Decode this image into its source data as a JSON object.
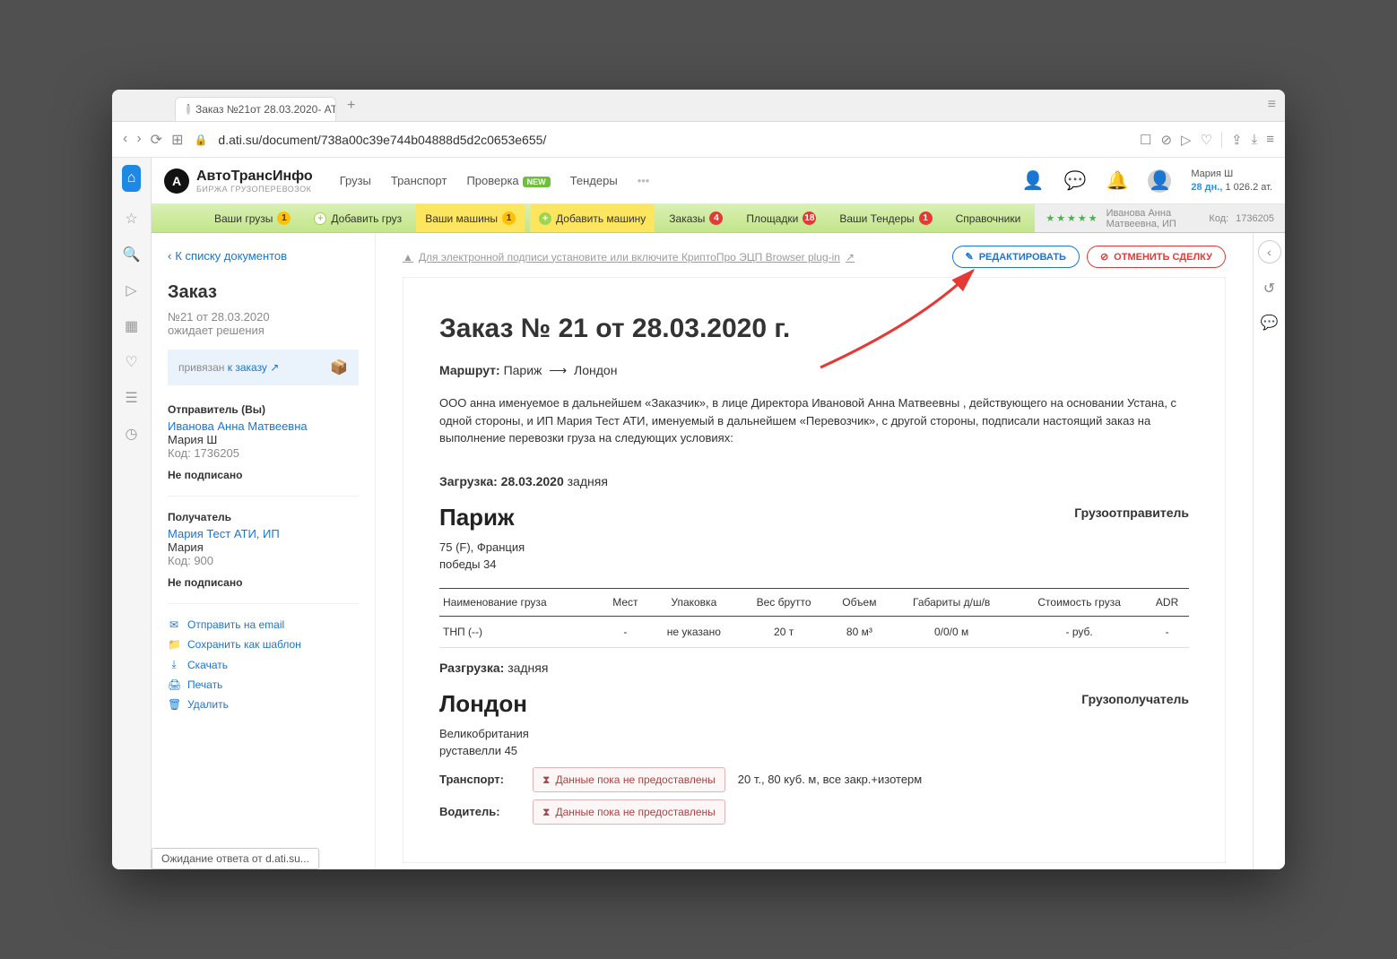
{
  "browser": {
    "tab_title": "Заказ №21от 28.03.2020- АТ",
    "url": "d.ati.su/document/738a00c39e744b04888d5d2c0653e655/",
    "status": "Ожидание ответа от d.ati.su..."
  },
  "brand": {
    "title": "АвтоТрансИнфо",
    "subtitle": "БИРЖА ГРУЗОПЕРЕВОЗОК"
  },
  "topnav": {
    "cargo": "Грузы",
    "transport": "Транспорт",
    "check": "Проверка",
    "new_badge": "NEW",
    "tenders": "Тендеры"
  },
  "user": {
    "name": "Мария Ш",
    "days": "28 дн.,",
    "rating": "1 026.2 ат."
  },
  "subnav": {
    "your_cargo": "Ваши грузы",
    "your_cargo_cnt": "1",
    "add_cargo": "Добавить груз",
    "your_vehicles": "Ваши машины",
    "your_vehicles_cnt": "1",
    "add_vehicle": "Добавить машину",
    "orders": "Заказы",
    "orders_cnt": "4",
    "platforms": "Площадки",
    "platforms_cnt": "18",
    "your_tenders": "Ваши Тендеры",
    "your_tenders_cnt": "1",
    "refs": "Справочники",
    "right_name": "Иванова Анна Матвеевна, ИП",
    "right_code_label": "Код:",
    "right_code": "1736205"
  },
  "left": {
    "back": "К списку документов",
    "title": "Заказ",
    "num_date": "№21 от 28.03.2020",
    "status": "ожидает решения",
    "attached_prefix": "привязан ",
    "attached_link": "к заказу",
    "sender_title": "Отправитель (Вы)",
    "sender_name": "Иванова Анна Матвеевна",
    "sender_person": "Мария Ш",
    "sender_code": "Код: 1736205",
    "not_signed": "Не подписано",
    "recipient_title": "Получатель",
    "recipient_name": "Мария Тест АТИ, ИП",
    "recipient_person": "Мария",
    "recipient_code": "Код: 900",
    "actions": {
      "email": "Отправить на email",
      "template": "Сохранить как шаблон",
      "download": "Скачать",
      "print": "Печать",
      "delete": "Удалить"
    }
  },
  "notice": "Для электронной подписи установите или включите КриптоПро ЭЦП Browser plug-in",
  "buttons": {
    "edit": "РЕДАКТИРОВАТЬ",
    "cancel": "ОТМЕНИТЬ СДЕЛКУ"
  },
  "doc": {
    "title": "Заказ №  21 от 28.03.2020 г.",
    "route_label": "Маршрут:",
    "route_from": "Париж",
    "route_to": "Лондон",
    "para": "ООО анна именуемое в дальнейшем «Заказчик», в лице Директора Ивановой Анна Матвеевны , действующего на основании Устана, с одной стороны, и ИП Мария Тест АТИ, именуемый в дальнейшем «Перевозчик», с другой стороны, подписали настоящий заказ на выполнение перевозки груза на следующих условиях:",
    "loading_label": "Загрузка:",
    "loading_date": "28.03.2020",
    "loading_type": "задняя",
    "city1": "Париж",
    "city1_sub": "75 (F), Франция",
    "city1_addr": "победы 34",
    "shipper": "Грузоотправитель",
    "table": {
      "h_name": "Наименование груза",
      "h_places": "Мест",
      "h_pack": "Упаковка",
      "h_gross": "Вес брутто",
      "h_vol": "Объем",
      "h_dims": "Габариты д/ш/в",
      "h_cost": "Стоимость груза",
      "h_adr": "ADR",
      "r_name": "ТНП (--)",
      "r_places": "-",
      "r_pack": "не указано",
      "r_gross": "20 т",
      "r_vol": "80 м³",
      "r_dims": "0/0/0 м",
      "r_cost": "- руб.",
      "r_adr": "-"
    },
    "unloading_label": "Разгрузка:",
    "unloading_type": "задняя",
    "city2": "Лондон",
    "city2_sub": "Великобритания",
    "city2_addr": "руставелли 45",
    "consignee": "Грузополучатель",
    "transport_label": "Транспорт:",
    "nodata": "Данные пока не предоставлены",
    "transport_spec": "20 т., 80 куб. м, все закр.+изотерм",
    "driver_label": "Водитель:"
  }
}
